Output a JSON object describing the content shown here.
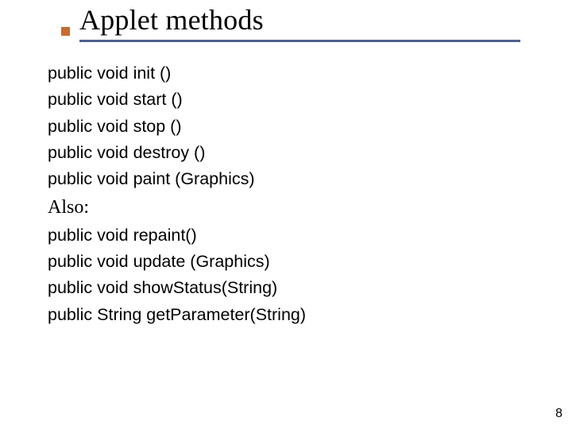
{
  "title": "Applet methods",
  "accent_color": "#c96a2b",
  "underline_color": "#4f5f8f",
  "methods_group_1": [
    "public void init ()",
    "public void start ()",
    "public void stop ()",
    "public void destroy ()",
    "public void paint (Graphics)"
  ],
  "also_label": "Also:",
  "methods_group_2": [
    "public void repaint()",
    "public void update (Graphics)",
    "public void showStatus(String)",
    "public String getParameter(String)"
  ],
  "page_number": "8"
}
